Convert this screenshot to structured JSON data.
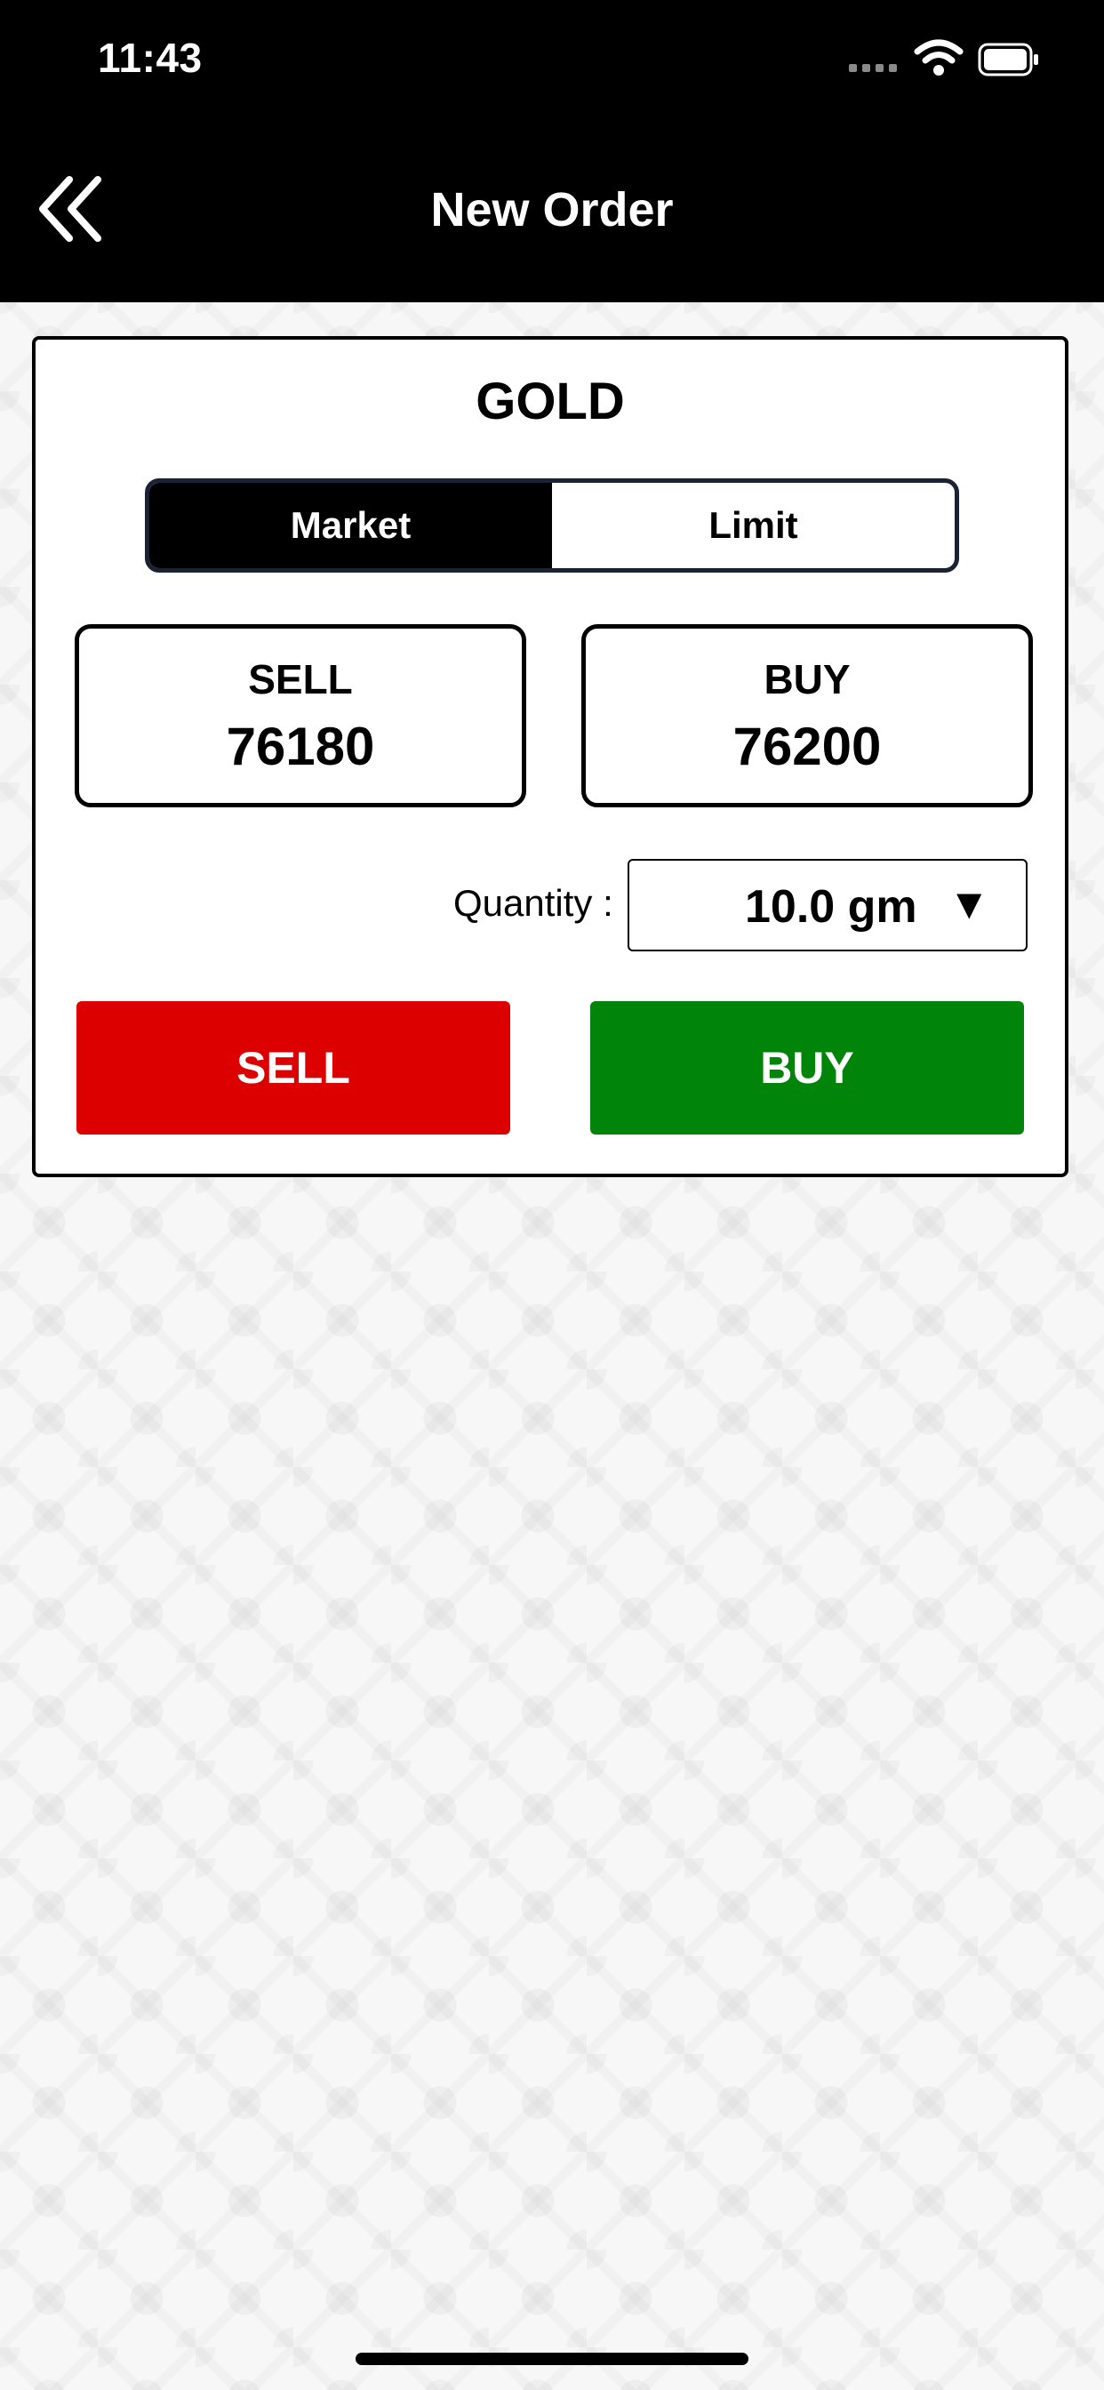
{
  "status_bar": {
    "time": "11:43"
  },
  "header": {
    "title": "New Order",
    "back_icon": "double-chevron-left-icon"
  },
  "order": {
    "product": "GOLD",
    "order_types": [
      "Market",
      "Limit"
    ],
    "selected_type": "Market",
    "sell_label": "SELL",
    "sell_price": "76180",
    "buy_label": "BUY",
    "buy_price": "76200",
    "quantity_label": "Quantity :",
    "quantity_value": "10.0 gm",
    "quantity_caret": "▼",
    "sell_button": "SELL",
    "buy_button": "BUY"
  },
  "colors": {
    "sell": "#dd0000",
    "buy": "#00850a",
    "header": "#000000"
  }
}
